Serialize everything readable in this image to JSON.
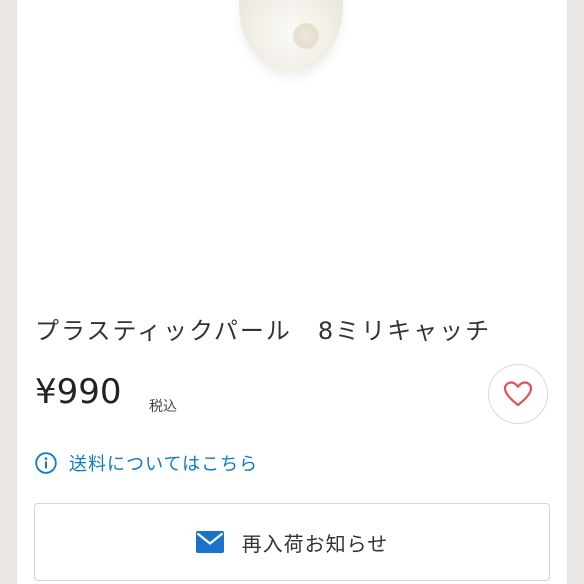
{
  "product": {
    "title": "プラスティックパール　8ミリキャッチ",
    "price": "¥990",
    "tax_label": "税込"
  },
  "favorite": {
    "icon": "heart-icon",
    "color": "#e0505a"
  },
  "shipping": {
    "label": "送料についてはこちら",
    "icon": "info-icon",
    "color": "#0d7bc6"
  },
  "notify": {
    "label": "再入荷お知らせ",
    "icon": "mail-icon",
    "color": "#1a73c8"
  }
}
